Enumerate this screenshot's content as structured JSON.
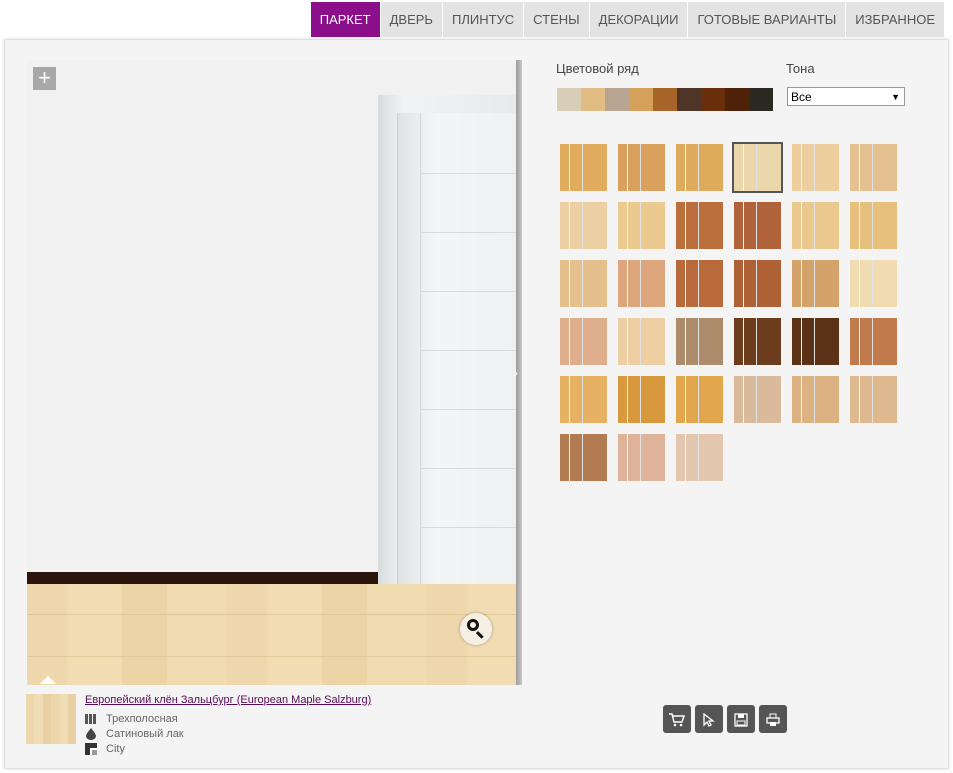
{
  "tabs": [
    {
      "label": "ПАРКЕТ",
      "active": true
    },
    {
      "label": "ДВЕРЬ",
      "active": false
    },
    {
      "label": "ПЛИНТУС",
      "active": false
    },
    {
      "label": "СТЕНЫ",
      "active": false
    },
    {
      "label": "ДЕКОРАЦИИ",
      "active": false
    },
    {
      "label": "ГОТОВЫЕ ВАРИАНТЫ",
      "active": false
    },
    {
      "label": "ИЗБРАННОЕ",
      "active": false
    }
  ],
  "colors": {
    "accent": "#8b0e8b",
    "link": "#5a0a5a"
  },
  "palette": {
    "label": "Цветовой ряд",
    "swatches": [
      "#d8cdb7",
      "#e1bd84",
      "#b7a592",
      "#d4a05a",
      "#a8652a",
      "#4f3527",
      "#6b2e0c",
      "#4d2209",
      "#2a2a23"
    ]
  },
  "tone": {
    "label": "Тона",
    "value": "Все"
  },
  "tiles": [
    [
      "#e2ac5e",
      "#d9a05e",
      "#deab5d",
      "#ecd7ad",
      "#edcf9f",
      "#e5c191"
    ],
    [
      "#eccfa3",
      "#ebc98f",
      "#bb6f3c",
      "#b0623a",
      "#ebc88e",
      "#e8c07e"
    ],
    [
      "#e6c08c",
      "#dea67c",
      "#b86a3d",
      "#ae6135",
      "#d4a26b",
      "#f0dcb0"
    ],
    [
      "#dfae8d",
      "#eecfa3",
      "#ad8c6b",
      "#6b3d1c",
      "#5c3217",
      "#c07a4c"
    ],
    [
      "#e7b163",
      "#d7983e",
      "#e0a74d",
      "#d9ba9b",
      "#dcb283",
      "#deb98f"
    ],
    [
      "#b27b52",
      "#dfb39a",
      "#e2c6ad"
    ]
  ],
  "selected_tile": [
    0,
    3
  ],
  "product": {
    "name": "Европейский клён Зальцбург (European Maple Salzburg)",
    "props": [
      {
        "icon": "three-strip-icon",
        "label": "Трехполосная"
      },
      {
        "icon": "drop-icon",
        "label": "Сатиновый лак"
      },
      {
        "icon": "collection-icon",
        "label": "City"
      }
    ]
  },
  "tools": [
    "cart-icon",
    "cursor-icon",
    "save-icon",
    "print-icon"
  ]
}
